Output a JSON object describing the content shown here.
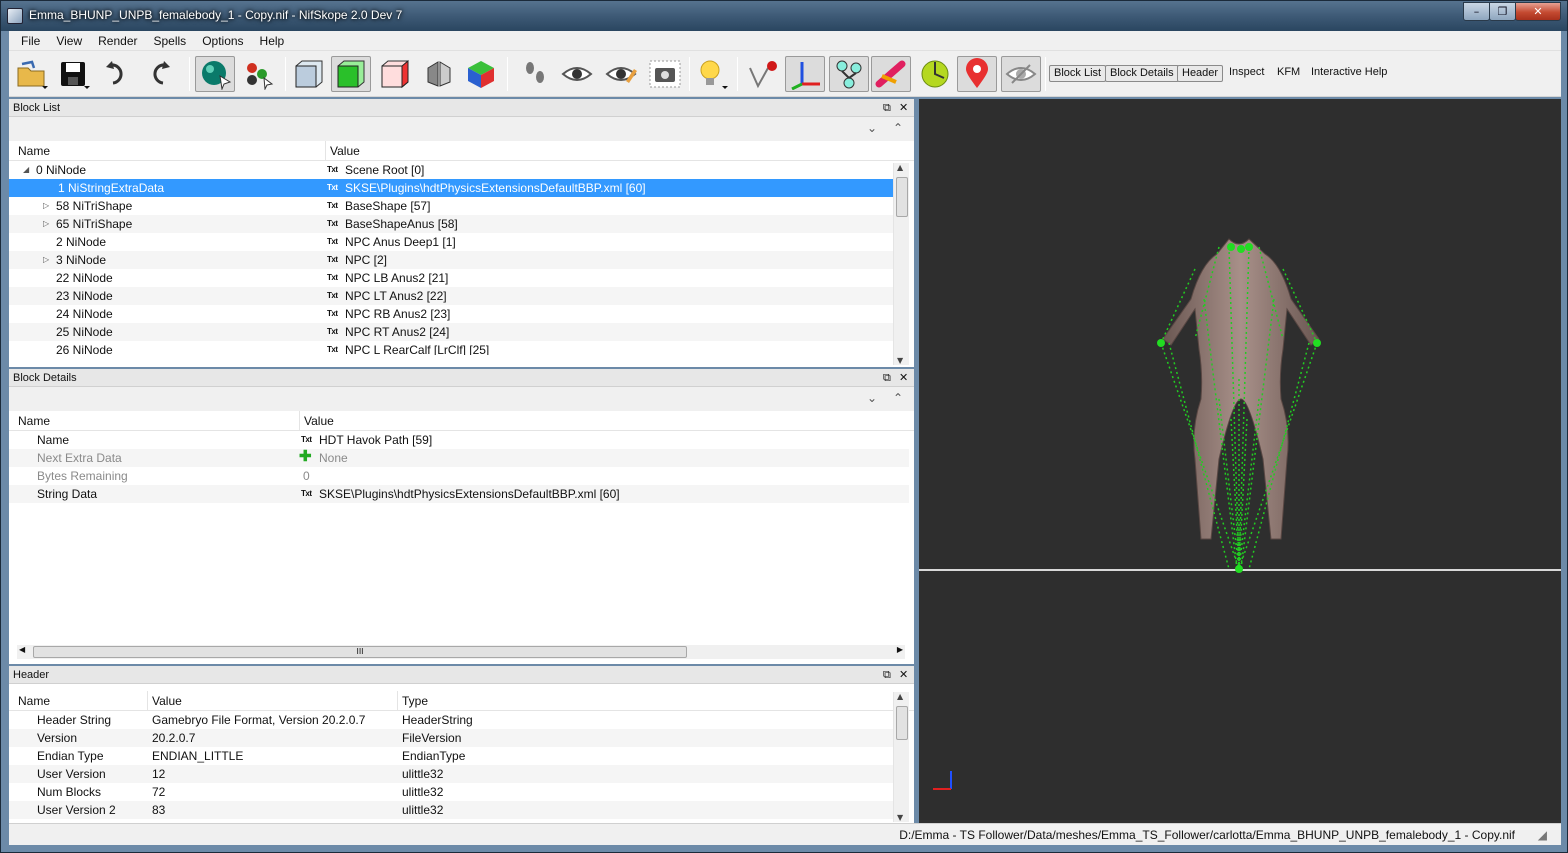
{
  "window": {
    "title": "Emma_BHUNP_UNPB_femalebody_1 - Copy.nif - NifSkope 2.0 Dev 7",
    "minimize": "–",
    "maximize": "❐",
    "close": "✕"
  },
  "menu": [
    "File",
    "View",
    "Render",
    "Spells",
    "Options",
    "Help"
  ],
  "toolbar": {
    "text_buttons": [
      "Block List",
      "Block Details",
      "Header",
      "Inspect",
      "KFM",
      "Interactive Help"
    ]
  },
  "block_list": {
    "title": "Block List",
    "columns": [
      "Name",
      "Value"
    ],
    "rows": [
      {
        "name": "0 NiNode",
        "value": "Scene Root [0]",
        "expander": "◢",
        "indent": 0
      },
      {
        "name": "1 NiStringExtraData",
        "value": "SKSE\\Plugins\\hdtPhysicsExtensionsDefaultBBP.xml [60]",
        "expander": "",
        "indent": 1,
        "selected": true
      },
      {
        "name": "58 NiTriShape",
        "value": "BaseShape [57]",
        "expander": "▷",
        "indent": 1
      },
      {
        "name": "65 NiTriShape",
        "value": "BaseShapeAnus [58]",
        "expander": "▷",
        "indent": 1
      },
      {
        "name": "2 NiNode",
        "value": "NPC Anus Deep1 [1]",
        "expander": "",
        "indent": 1
      },
      {
        "name": "3 NiNode",
        "value": "NPC [2]",
        "expander": "▷",
        "indent": 1
      },
      {
        "name": "22 NiNode",
        "value": "NPC LB Anus2 [21]",
        "expander": "",
        "indent": 1
      },
      {
        "name": "23 NiNode",
        "value": "NPC LT Anus2 [22]",
        "expander": "",
        "indent": 1
      },
      {
        "name": "24 NiNode",
        "value": "NPC RB Anus2 [23]",
        "expander": "",
        "indent": 1
      },
      {
        "name": "25 NiNode",
        "value": "NPC RT Anus2 [24]",
        "expander": "",
        "indent": 1
      },
      {
        "name": "26 NiNode",
        "value": "NPC L RearCalf [LrClf] [25]",
        "expander": "",
        "indent": 1
      }
    ]
  },
  "block_details": {
    "title": "Block Details",
    "columns": [
      "Name",
      "Value"
    ],
    "rows": [
      {
        "name": "Name",
        "value": "HDT Havok Path [59]",
        "icon": "Txt",
        "dim": false
      },
      {
        "name": "Next Extra Data",
        "value": "None",
        "icon": "plus",
        "dim": true
      },
      {
        "name": "Bytes Remaining",
        "value": "0",
        "icon": "",
        "dim": true
      },
      {
        "name": "String Data",
        "value": "SKSE\\Plugins\\hdtPhysicsExtensionsDefaultBBP.xml [60]",
        "icon": "Txt",
        "dim": false
      }
    ],
    "hscroll_grip": "III"
  },
  "header": {
    "title": "Header",
    "columns": [
      "Name",
      "Value",
      "Type"
    ],
    "rows": [
      {
        "name": "Header String",
        "value": "Gamebryo File Format, Version 20.2.0.7",
        "type": "HeaderString"
      },
      {
        "name": "Version",
        "value": "20.2.0.7",
        "type": "FileVersion"
      },
      {
        "name": "Endian Type",
        "value": "ENDIAN_LITTLE",
        "type": "EndianType"
      },
      {
        "name": "User Version",
        "value": "12",
        "type": "ulittle32"
      },
      {
        "name": "Num Blocks",
        "value": "72",
        "type": "ulittle32"
      },
      {
        "name": "User Version 2",
        "value": "83",
        "type": "ulittle32"
      }
    ]
  },
  "txt_label": "Txt",
  "status": {
    "path": "D:/Emma - TS Follower/Data/meshes/Emma_TS_Follower/carlotta/Emma_BHUNP_UNPB_femalebody_1 - Copy.nif"
  },
  "colors": {
    "selection": "#3399ff",
    "viewport_bg": "#2e2e2e",
    "skeleton": "#22cc22"
  }
}
